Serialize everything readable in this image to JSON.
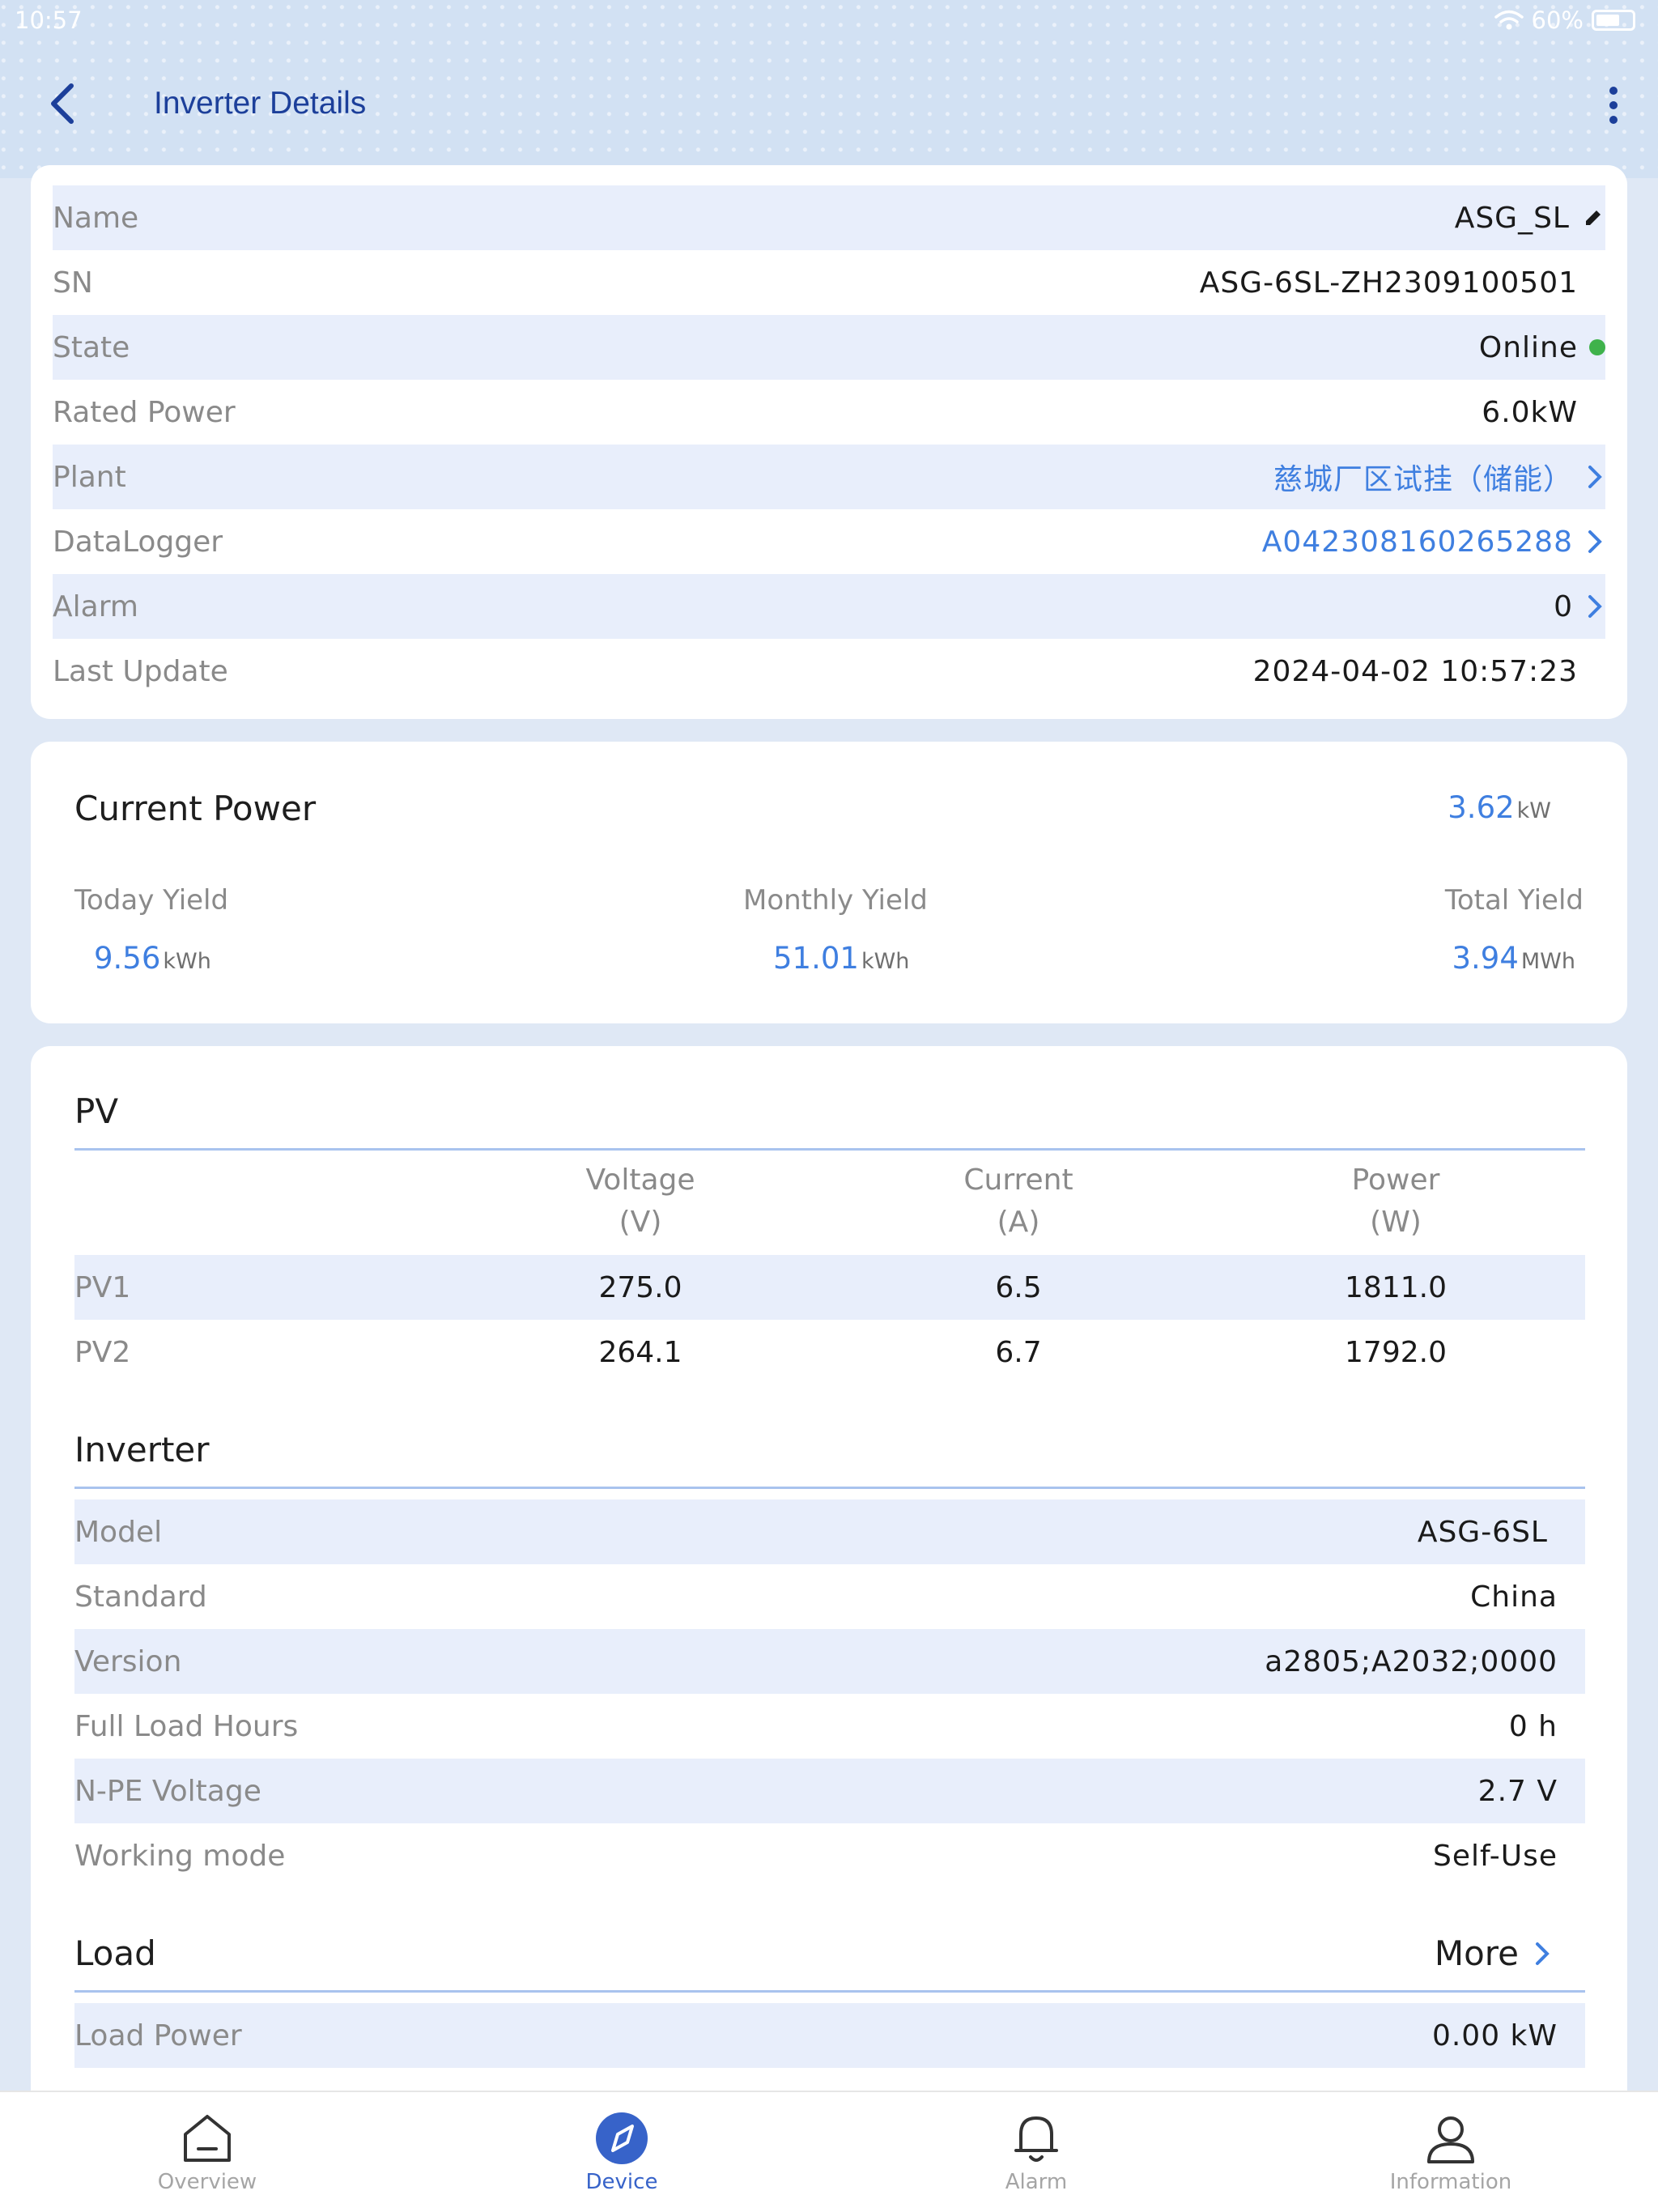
{
  "status_bar": {
    "time": "10:57",
    "battery": "60%"
  },
  "header": {
    "title": "Inverter Details"
  },
  "device_info": [
    {
      "label": "Name",
      "value": "ASG_SL"
    },
    {
      "label": "SN",
      "value": "ASG-6SL-ZH2309100501"
    },
    {
      "label": "State",
      "value": "Online"
    },
    {
      "label": "Rated Power",
      "value": "6.0kW"
    },
    {
      "label": "Plant",
      "value": "慈城厂区试挂（储能）"
    },
    {
      "label": "DataLogger",
      "value": "A042308160265288"
    },
    {
      "label": "Alarm",
      "value": "0"
    },
    {
      "label": "Last Update",
      "value": "2024-04-02 10:57:23"
    }
  ],
  "power": {
    "title": "Current Power",
    "current_value": "3.62",
    "current_unit": "kW",
    "today_label": "Today Yield",
    "today_value": "9.56",
    "today_unit": "kWh",
    "monthly_label": "Monthly Yield",
    "monthly_value": "51.01",
    "monthly_unit": "kWh",
    "total_label": "Total Yield",
    "total_value": "3.94",
    "total_unit": "MWh"
  },
  "pv": {
    "title": "PV",
    "headers": [
      {
        "name": "Voltage",
        "unit": "(V)"
      },
      {
        "name": "Current",
        "unit": "(A)"
      },
      {
        "name": "Power",
        "unit": "(W)"
      }
    ],
    "rows": [
      {
        "name": "PV1",
        "voltage": "275.0",
        "current": "6.5",
        "power": "1811.0"
      },
      {
        "name": "PV2",
        "voltage": "264.1",
        "current": "6.7",
        "power": "1792.0"
      }
    ]
  },
  "inverter": {
    "title": "Inverter",
    "rows": [
      {
        "label": "Model",
        "value": "ASG-6SL"
      },
      {
        "label": "Standard",
        "value": "China"
      },
      {
        "label": "Version",
        "value": "a2805;A2032;0000"
      },
      {
        "label": "Full Load Hours",
        "value": "0 h"
      },
      {
        "label": "N-PE Voltage",
        "value": "2.7 V"
      },
      {
        "label": "Working mode",
        "value": "Self-Use"
      }
    ]
  },
  "load": {
    "title": "Load",
    "more_label": "More",
    "rows": [
      {
        "label": "Load Power",
        "value": "0.00 kW"
      }
    ]
  },
  "tabs": [
    {
      "label": "Overview",
      "icon": "home-icon",
      "active": false
    },
    {
      "label": "Device",
      "icon": "compass-icon",
      "active": true
    },
    {
      "label": "Alarm",
      "icon": "bell-icon",
      "active": false
    },
    {
      "label": "Information",
      "icon": "person-icon",
      "active": false
    }
  ],
  "colors": {
    "accent": "#3F7FE0",
    "title_blue": "#1C3F9A",
    "online_green": "#3FB24B",
    "row_shade": "#E8EEFB"
  }
}
